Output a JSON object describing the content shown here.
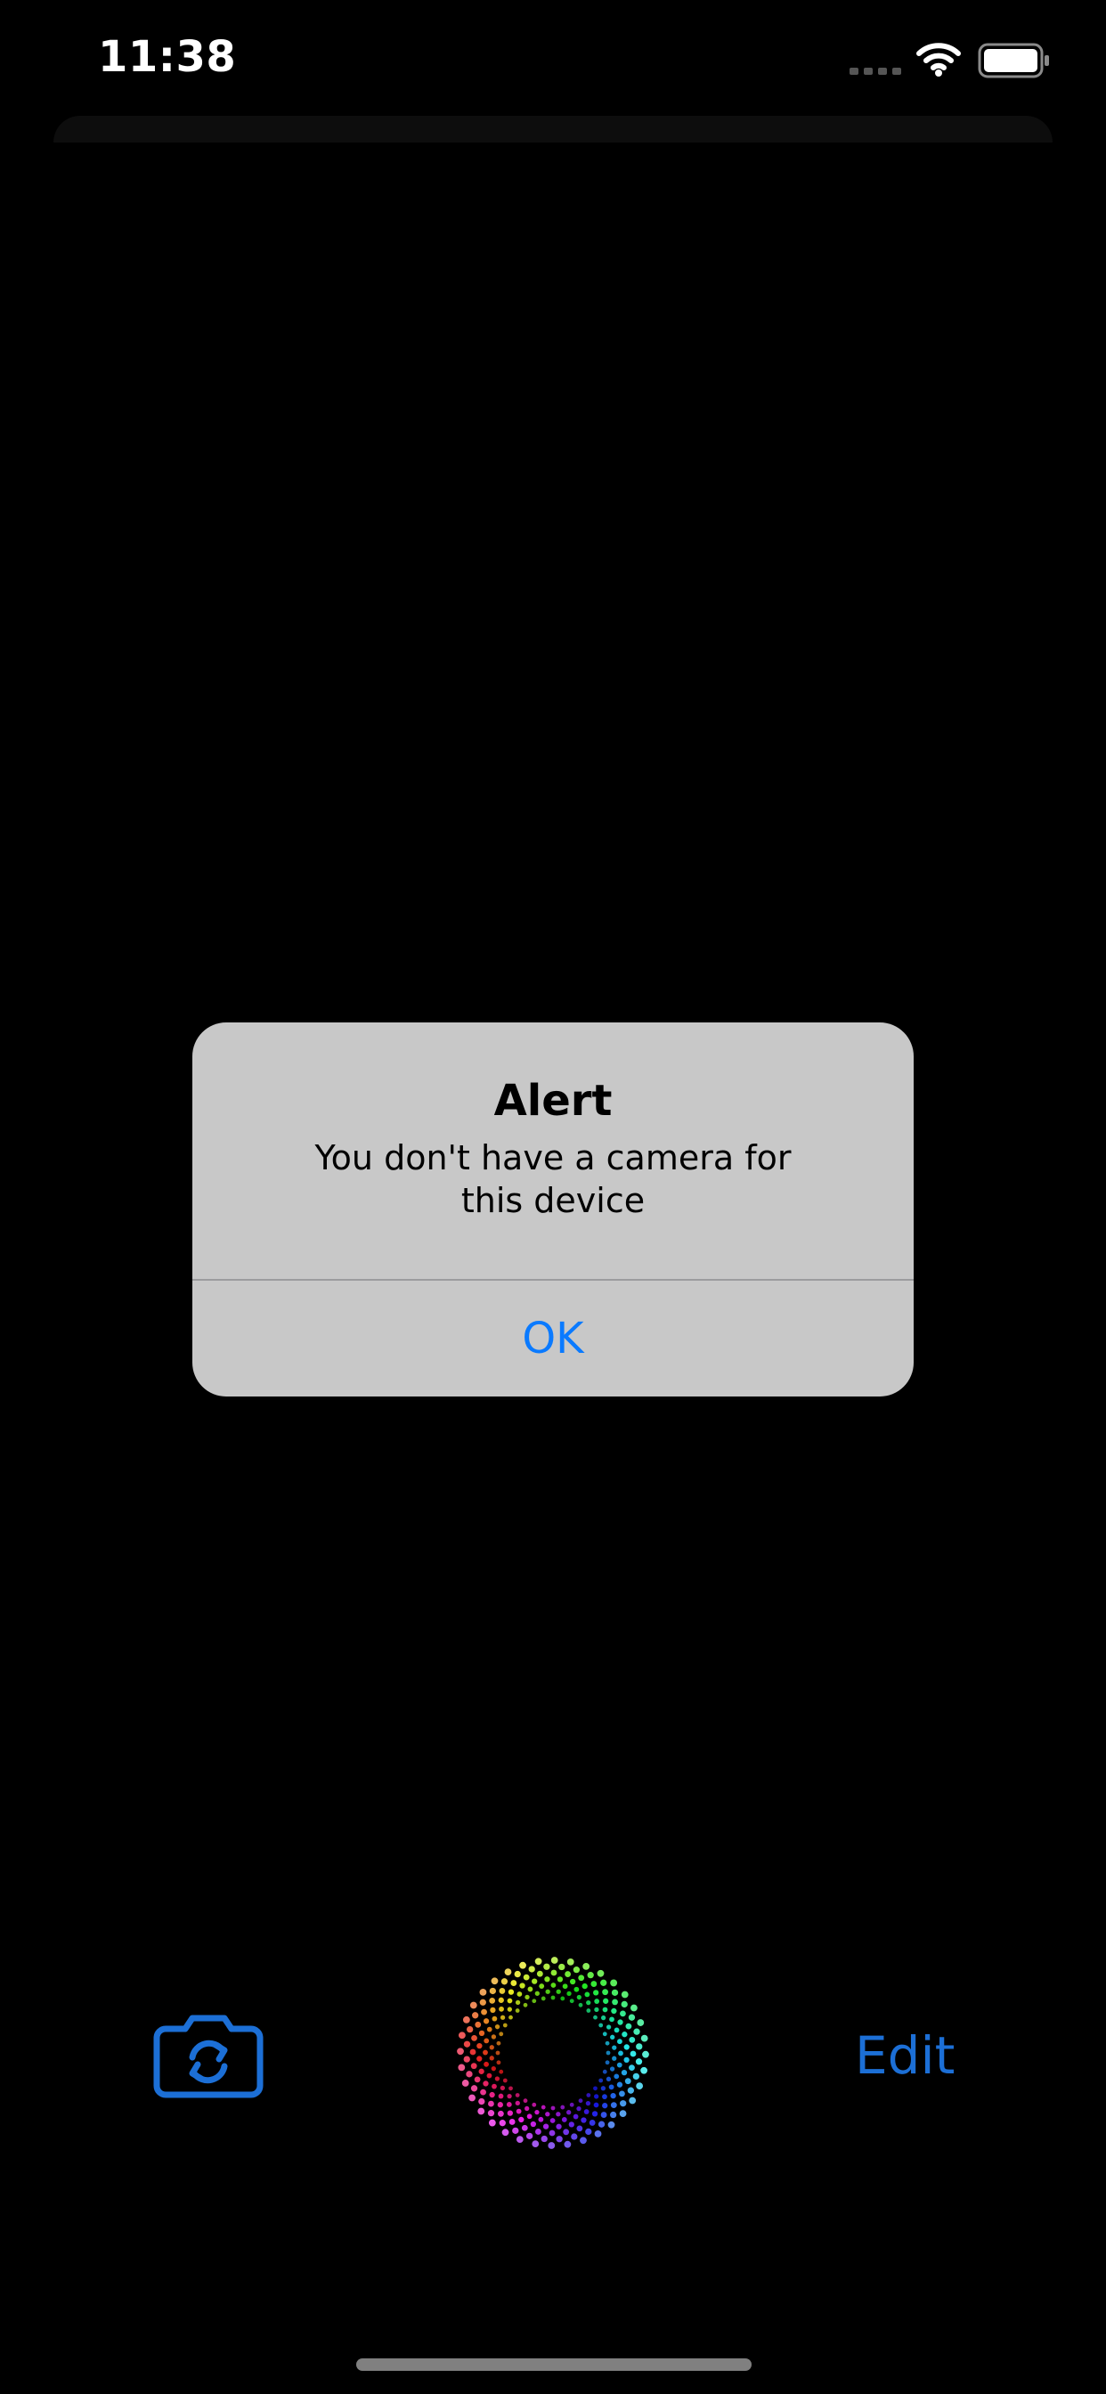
{
  "status_bar": {
    "time": "11:38"
  },
  "alert": {
    "title": "Alert",
    "message": "You don't have a camera for this device",
    "ok_label": "OK"
  },
  "toolbar": {
    "camera_switch_icon": "camera-rotate-icon",
    "shutter_icon": "rainbow-shutter-icon",
    "edit_label": "Edit"
  },
  "colors": {
    "background": "#000000",
    "alert_background": "#c8c8c8",
    "alert_button": "#0a7aff",
    "accent": "#1c6fd6"
  }
}
